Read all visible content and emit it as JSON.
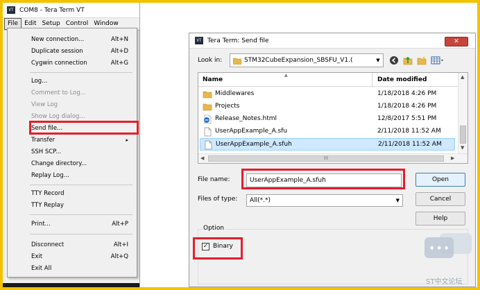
{
  "teraterm": {
    "title": "COM8 - Tera Term VT",
    "app_icon_text": "VT",
    "menubar": [
      "File",
      "Edit",
      "Setup",
      "Control",
      "Window"
    ],
    "file_menu": [
      {
        "label": "New connection...",
        "shortcut": "Alt+N",
        "disabled": false
      },
      {
        "label": "Duplicate session",
        "shortcut": "Alt+D",
        "disabled": false
      },
      {
        "label": "Cygwin connection",
        "shortcut": "Alt+G",
        "disabled": false
      },
      {
        "label": "Log...",
        "shortcut": "",
        "disabled": false
      },
      {
        "label": "Comment to Log...",
        "shortcut": "",
        "disabled": true
      },
      {
        "label": "View Log",
        "shortcut": "",
        "disabled": true
      },
      {
        "label": "Show Log dialog...",
        "shortcut": "",
        "disabled": true
      },
      {
        "label": "Send file...",
        "shortcut": "",
        "disabled": false,
        "highlighted": true
      },
      {
        "label": "Transfer",
        "shortcut": "",
        "disabled": false,
        "submenu": true
      },
      {
        "label": "SSH SCP...",
        "shortcut": "",
        "disabled": false
      },
      {
        "label": "Change directory...",
        "shortcut": "",
        "disabled": false
      },
      {
        "label": "Replay Log...",
        "shortcut": "",
        "disabled": false
      },
      {
        "label": "TTY Record",
        "shortcut": "",
        "disabled": false
      },
      {
        "label": "TTY Replay",
        "shortcut": "",
        "disabled": false
      },
      {
        "label": "Print...",
        "shortcut": "Alt+P",
        "disabled": false
      },
      {
        "label": "Disconnect",
        "shortcut": "Alt+I",
        "disabled": false
      },
      {
        "label": "Exit",
        "shortcut": "Alt+Q",
        "disabled": false
      },
      {
        "label": "Exit All",
        "shortcut": "",
        "disabled": false
      }
    ],
    "submenu_arrow": "▸"
  },
  "dialog": {
    "title": "Tera Term: Send file",
    "close_glyph": "✕",
    "look_in_label": "Look in:",
    "look_in_value": "STM32CubeExpansion_SBSFU_V1.(",
    "columns": {
      "name": "Name",
      "date": "Date modified"
    },
    "files": [
      {
        "name": "Middlewares",
        "date": "1/18/2018 4:26 PM",
        "type": "folder",
        "selected": false
      },
      {
        "name": "Projects",
        "date": "1/18/2018 4:26 PM",
        "type": "folder",
        "selected": false
      },
      {
        "name": "Release_Notes.html",
        "date": "12/8/2017 5:51 PM",
        "type": "html",
        "selected": false
      },
      {
        "name": "UserAppExample_A.sfu",
        "date": "2/11/2018 11:52 AM",
        "type": "file",
        "selected": false
      },
      {
        "name": "UserAppExample_A.sfuh",
        "date": "2/11/2018 11:52 AM",
        "type": "file",
        "selected": true
      }
    ],
    "hscroll_thumb_text": "III",
    "file_name_label": "File name:",
    "file_name_value": "UserAppExample_A.sfuh",
    "files_of_type_label": "Files of type:",
    "files_of_type_value": "All(*.*)",
    "buttons": {
      "open": "Open",
      "cancel": "Cancel",
      "help": "Help"
    },
    "option_label": "Option",
    "binary_label": "Binary",
    "binary_checked": true,
    "check_glyph": "✓"
  },
  "watermark": {
    "dots": "•••",
    "text": "ST中文论坛"
  },
  "colors": {
    "frame": "#f2c200",
    "highlight": "#e41e2b",
    "selection": "#cde8ff"
  }
}
